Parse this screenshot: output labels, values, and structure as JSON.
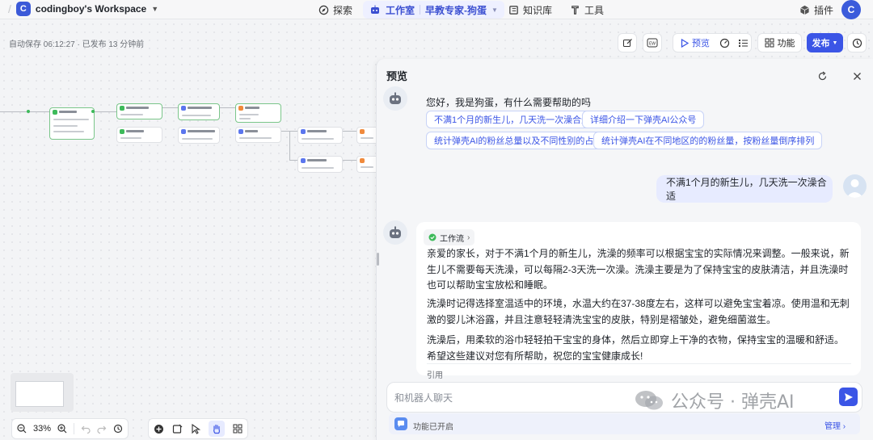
{
  "topbar": {
    "workspace_initial": "C",
    "workspace_name": "codingboy's Workspace",
    "explore": "探索",
    "studio": "工作室",
    "project": "早教专家-狗蛋",
    "knowledge": "知识库",
    "tools": "工具",
    "plugins": "插件",
    "user_initial": "C"
  },
  "toolbar": {
    "autosave": "自动保存 06:12:27 · 已发布 13 分钟前",
    "preview": "预览",
    "features": "功能",
    "publish": "发布"
  },
  "zoom": {
    "value": "33%"
  },
  "preview": {
    "title": "预览",
    "greeting": "您好，我是狗蛋，有什么需要帮助的吗",
    "suggestions": [
      "不满1个月的新生儿，几天洗一次澡合适",
      "详细介绍一下弹壳AI公众号",
      "统计弹壳AI的粉丝总量以及不同性别的占比",
      "统计弹壳AI在不同地区的的粉丝量，按粉丝量倒序排列"
    ],
    "user_message": "不满1个月的新生儿，几天洗一次澡合适",
    "workflow_tag": "工作流",
    "answer_paragraphs": [
      "亲爱的家长，对于不满1个月的新生儿，洗澡的频率可以根据宝宝的实际情况来调整。一般来说，新生儿不需要每天洗澡，可以每隔2-3天洗一次澡。洗澡主要是为了保持宝宝的皮肤清洁，并且洗澡时也可以帮助宝宝放松和睡眠。",
      "洗澡时记得选择室温适中的环境，水温大约在37-38度左右，这样可以避免宝宝着凉。使用温和无刺激的婴儿沐浴露，并且注意轻轻清洗宝宝的皮肤，特别是褶皱处，避免细菌滋生。",
      "洗澡后，用柔软的浴巾轻轻拍干宝宝的身体，然后立即穿上干净的衣物，保持宝宝的温暖和舒适。希望这些建议对您有所帮助，祝您的宝宝健康成长!"
    ],
    "citation": "引用",
    "input_placeholder": "和机器人聊天",
    "feature_status": "功能已开启",
    "manage": "管理"
  },
  "watermark": {
    "text": "公众号 · 弹壳AI"
  },
  "colors": {
    "accent": "#3b55e6",
    "node_ok": "#3dba5a"
  }
}
